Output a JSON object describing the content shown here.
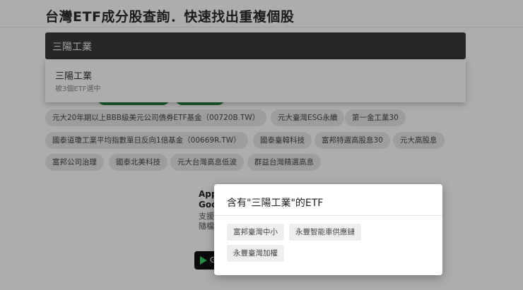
{
  "header": {
    "title": "台灣ETF成分股查詢．快速找出重複個股"
  },
  "search": {
    "value": "三陽工業"
  },
  "dropdown": {
    "items": [
      {
        "name": "三陽工業",
        "count_text": "被3個ETF選中"
      }
    ]
  },
  "chips": [
    "元大20年期以上BBB級美元公司債券ETF基金（00720B.TW）",
    "元大臺灣ESG永續",
    "第一金工業30",
    "國泰道瓊工業平均指數單日反向1倍基金（00669R.TW）",
    "國泰臺韓科技",
    "富邦特選高股息30",
    "元大高股息",
    "富邦公司治理",
    "國泰北美科技",
    "元大台灣高息低波",
    "群益台灣精選高息"
  ],
  "app_promo": {
    "title_line1": "App",
    "title_line2": "Goo",
    "line1": "支援",
    "line2": "隨檔",
    "store_button": "G"
  },
  "modal": {
    "title": "含有\"三陽工業\"的ETF",
    "etfs": [
      "富邦臺灣中小",
      "永豐智能車供應鏈",
      "永豐臺灣加權"
    ]
  },
  "colors": {
    "search_bg": "#3a3a3a",
    "chip_green": "#1f8a3c",
    "overlay": "rgba(0,0,0,0.32)"
  }
}
